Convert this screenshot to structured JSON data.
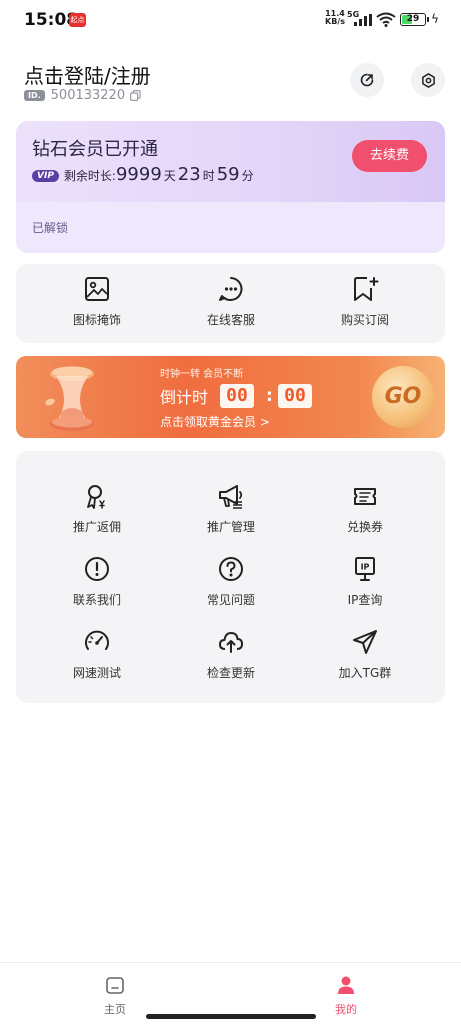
{
  "status_bar": {
    "time": "15:08",
    "app_badge": "起点",
    "net_speed_value": "11.4",
    "net_speed_unit": "KB/s",
    "signal_type": "5G",
    "battery": "29"
  },
  "profile": {
    "login_label": "点击登陆/注册",
    "id_badge": "ID.",
    "id_number": "500133220"
  },
  "vip": {
    "title": "钻石会员已开通",
    "vip_tag": "VIP",
    "remaining_label": "剩余时长:",
    "days_value": "9999",
    "days_unit": "天",
    "hours_value": "23",
    "hours_unit": "时",
    "minutes_value": "59",
    "minutes_unit": "分",
    "renew_button": "去续费",
    "unlocked_label": "已解锁"
  },
  "quick_actions": [
    {
      "label": "图标掩饰",
      "icon": "image-icon"
    },
    {
      "label": "在线客服",
      "icon": "chat-bubble-icon"
    },
    {
      "label": "购买订阅",
      "icon": "bookmark-add-icon"
    }
  ],
  "promo": {
    "slogan": "时钟一转 会员不断",
    "countdown_label": "倒计时",
    "countdown_minutes": "00",
    "countdown_seconds": "00",
    "claim_text": "点击领取黄金会员 >",
    "go_button": "GO"
  },
  "tools": [
    {
      "label": "推广返佣",
      "icon": "referral-commission-icon"
    },
    {
      "label": "推广管理",
      "icon": "megaphone-icon"
    },
    {
      "label": "兑换券",
      "icon": "coupon-icon"
    },
    {
      "label": "联系我们",
      "icon": "exclamation-circle-icon"
    },
    {
      "label": "常见问题",
      "icon": "question-circle-icon"
    },
    {
      "label": "IP查询",
      "icon": "ip-sign-icon"
    },
    {
      "label": "网速测试",
      "icon": "speedometer-icon"
    },
    {
      "label": "检查更新",
      "icon": "cloud-upload-icon"
    },
    {
      "label": "加入TG群",
      "icon": "paper-plane-icon"
    }
  ],
  "bottom_nav": [
    {
      "label": "主页",
      "icon": "home-icon",
      "active": false
    },
    {
      "label": "我的",
      "icon": "person-icon",
      "active": true
    }
  ],
  "colors": {
    "accent": "#f0506e",
    "vip_purple": "#5c3fa6",
    "promo_orange": "#f06d3f"
  }
}
